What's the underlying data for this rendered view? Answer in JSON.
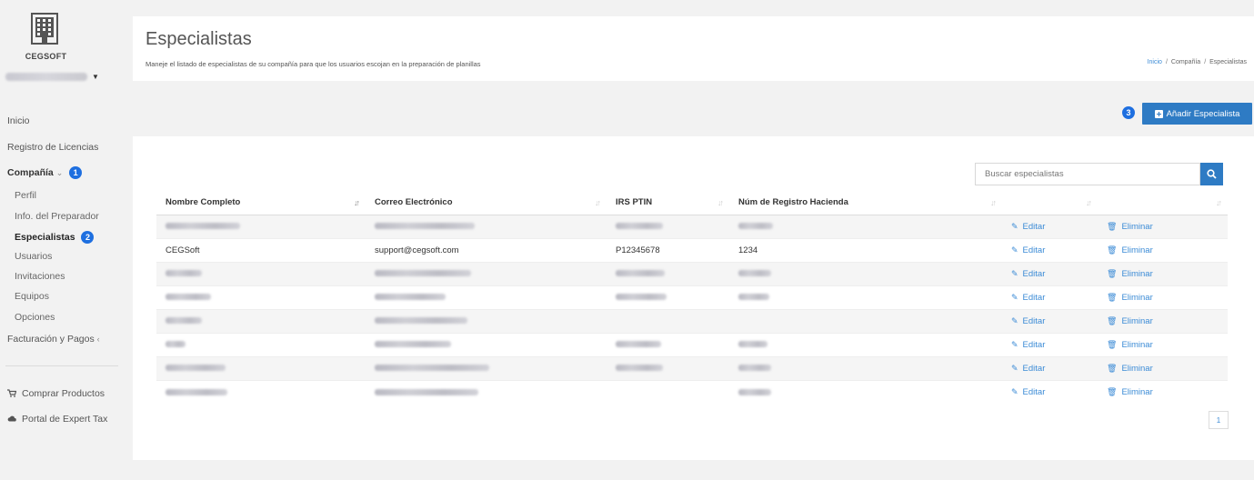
{
  "sidebar": {
    "company_name": "CEGSOFT",
    "user_email": "",
    "nav": {
      "inicio": "Inicio",
      "registro": "Registro de Licencias",
      "compania": "Compañía",
      "compania_badge": "1",
      "perfil": "Perfil",
      "preparador": "Info. del Preparador",
      "especialistas": "Especialistas",
      "especialistas_badge": "2",
      "usuarios": "Usuarios",
      "invitaciones": "Invitaciones",
      "equipos": "Equipos",
      "opciones": "Opciones",
      "facturacion": "Facturación y Pagos",
      "comprar": "Comprar Productos",
      "portal": "Portal de Expert Tax"
    }
  },
  "header": {
    "title": "Especialistas",
    "description": "Maneje el listado de especialistas de su compañía para que los usuarios escojan en la preparación de planillas",
    "breadcrumb": [
      "Inicio",
      "Compañía",
      "Especialistas"
    ]
  },
  "toolbar": {
    "add_label": "Añadir Especialista",
    "add_badge": "3"
  },
  "search": {
    "placeholder": "Buscar especialistas",
    "value": ""
  },
  "table": {
    "columns": [
      "Nombre Completo",
      "Correo Electrónico",
      "IRS PTIN",
      "Núm de Registro Hacienda"
    ],
    "edit_label": "Editar",
    "delete_label": "Eliminar",
    "rows": [
      {
        "name": "",
        "email": "",
        "ptin": "",
        "reg": ""
      },
      {
        "name": "CEGSoft",
        "email": "support@cegsoft.com",
        "ptin": "P12345678",
        "reg": "1234"
      },
      {
        "name": "",
        "email": "",
        "ptin": "",
        "reg": ""
      },
      {
        "name": "",
        "email": "",
        "ptin": "",
        "reg": ""
      },
      {
        "name": "",
        "email": "",
        "ptin": "",
        "reg": ""
      },
      {
        "name": "",
        "email": "",
        "ptin": "",
        "reg": ""
      },
      {
        "name": "",
        "email": "",
        "ptin": "",
        "reg": ""
      },
      {
        "name": "",
        "email": "",
        "ptin": "",
        "reg": ""
      }
    ]
  },
  "pagination": {
    "current": "1"
  },
  "colors": {
    "accent": "#2e7bc4",
    "link": "#3b8bd6",
    "badge": "#1e6fe0"
  }
}
